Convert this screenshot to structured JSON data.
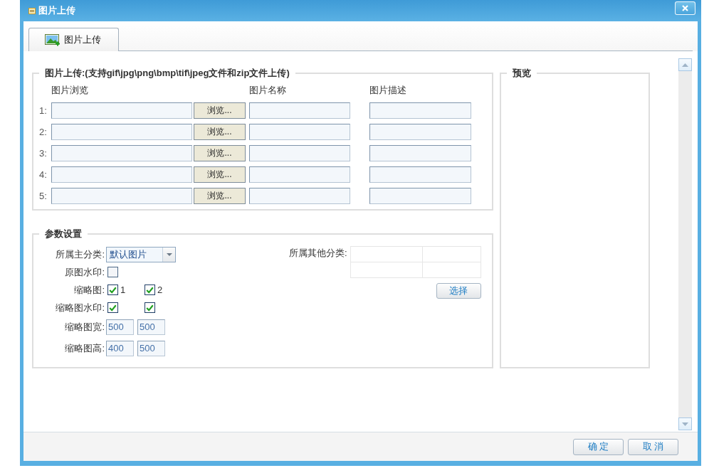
{
  "window": {
    "title": "图片上传"
  },
  "tabs": [
    {
      "label": "图片上传",
      "selected": true
    }
  ],
  "upload": {
    "legend": "图片上传:(支持gif\\jpg\\png\\bmp\\tif\\jpeg文件和zip文件上传)",
    "columns": [
      "图片浏览",
      "图片名称",
      "图片描述"
    ],
    "rows": [
      {
        "number": "1:",
        "browse_button": "浏览..."
      },
      {
        "number": "2:",
        "browse_button": "浏览..."
      },
      {
        "number": "3:",
        "browse_button": "浏览..."
      },
      {
        "number": "4:",
        "browse_button": "浏览..."
      },
      {
        "number": "5:",
        "browse_button": "浏览..."
      }
    ]
  },
  "params": {
    "legend": "参数设置",
    "fields": [
      {
        "kind": "select",
        "label": "所属主分类:",
        "value": "默认图片"
      },
      {
        "kind": "checks",
        "label": "原图水印:",
        "options": [
          {
            "checked": false
          }
        ]
      },
      {
        "kind": "checks",
        "label": "缩略图:",
        "options": [
          {
            "label": "1",
            "checked": true
          },
          {
            "label": "2",
            "checked": true
          }
        ]
      },
      {
        "kind": "checks",
        "label": "缩略图水印:",
        "options": [
          {
            "checked": true
          },
          {
            "checked": true
          }
        ]
      },
      {
        "kind": "inputs",
        "label": "缩略图宽:",
        "values": [
          "500",
          "500"
        ]
      },
      {
        "kind": "inputs",
        "label": "缩略图高:",
        "values": [
          "400",
          "500"
        ]
      }
    ],
    "other_category": {
      "label": "所属其他分类:",
      "button": "选择"
    }
  },
  "preview": {
    "legend": "预览"
  },
  "footer": {
    "buttons": [
      "确 定",
      "取 消"
    ]
  }
}
